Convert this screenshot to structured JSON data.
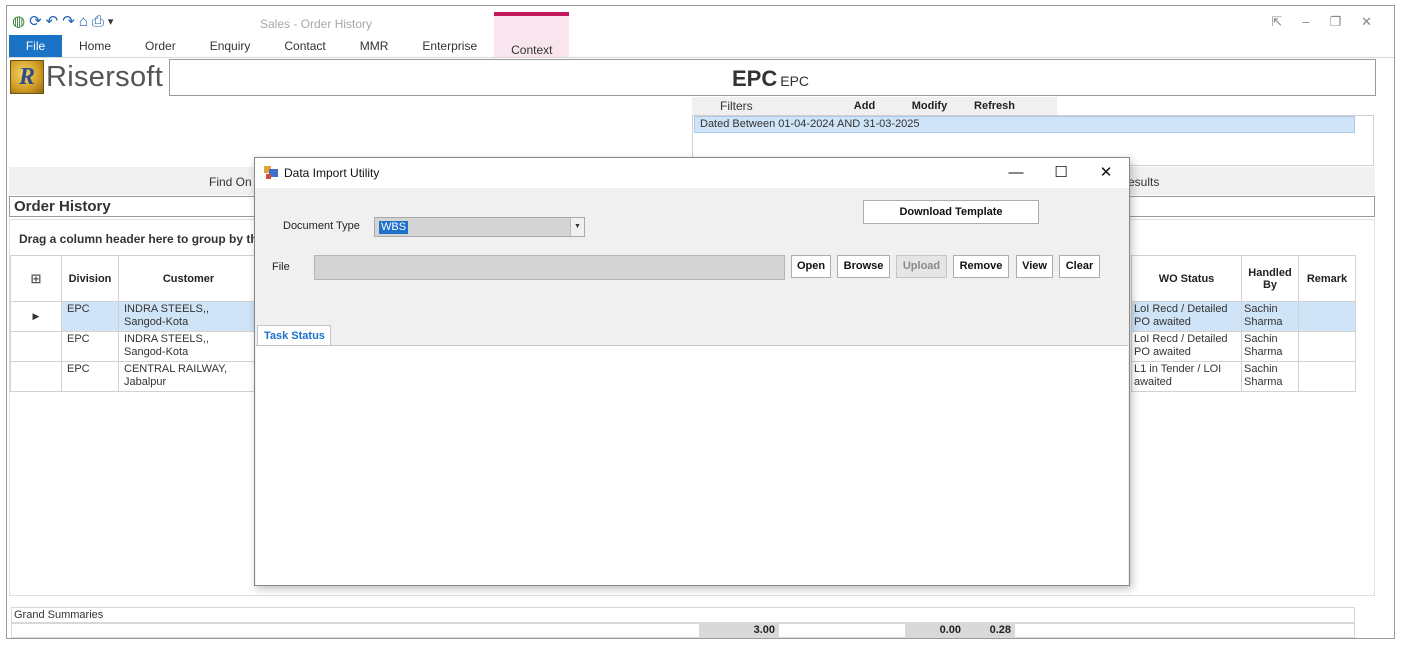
{
  "app": {
    "title": "Sales - Order History",
    "logo_text": "Risersoft",
    "logo_mark": "R"
  },
  "qat": {
    "icons": [
      "app-icon",
      "refresh-icon",
      "undo-icon",
      "redo-icon",
      "home-icon",
      "print-icon",
      "dropdown-icon"
    ],
    "glyphs": [
      "◍",
      "⟳",
      "↶",
      "↷",
      "⌂",
      "⎙",
      "▾"
    ]
  },
  "window_controls": {
    "restore_ribbon": "⇱",
    "minimize": "–",
    "restore": "❐",
    "close": "✕"
  },
  "ribbon": {
    "tabs": [
      "File",
      "Home",
      "Order",
      "Enquiry",
      "Contact",
      "MMR",
      "Enterprise",
      "Context"
    ],
    "context_color": "#c2185b"
  },
  "header": {
    "title": "EPC",
    "subtitle": "EPC"
  },
  "filters": {
    "label": "Filters",
    "add": "Add",
    "modify": "Modify",
    "refresh": "Refresh",
    "items": [
      "Dated Between  01-04-2024 AND 31-03-2025"
    ]
  },
  "find": {
    "label": "Find On",
    "results_label": "esults"
  },
  "section": {
    "title": "Order History",
    "group_hint": "Drag a column header here to group by th"
  },
  "grid": {
    "columns": [
      "Division",
      "Customer"
    ],
    "right_columns": [
      "WO Status",
      "Handled By",
      "Remark"
    ],
    "rows": [
      {
        "division": "EPC",
        "customer": "INDRA STEELS,, Sangod-Kota",
        "wo_status": "LoI Recd / Detailed PO awaited",
        "handled_by": "Sachin Sharma",
        "remark": "",
        "selected": true
      },
      {
        "division": "EPC",
        "customer": "INDRA STEELS,, Sangod-Kota",
        "wo_status": "LoI Recd / Detailed PO awaited",
        "handled_by": "Sachin Sharma",
        "remark": "",
        "selected": false
      },
      {
        "division": "EPC",
        "customer": "CENTRAL RAILWAY, Jabalpur",
        "wo_status": "L1 in Tender / LOI awaited",
        "handled_by": "Sachin Sharma",
        "remark": "",
        "selected": false
      }
    ]
  },
  "summaries": {
    "label": "Grand Summaries",
    "values": [
      "3.00",
      "0.00",
      "0.28"
    ]
  },
  "dialog": {
    "title": "Data Import Utility",
    "controls": {
      "minimize": "—",
      "maximize": "☐",
      "close": "✕"
    },
    "doc_type_label": "Document Type",
    "doc_type_value": "WBS",
    "download_template": "Download Template",
    "file_label": "File",
    "file_value": "",
    "buttons": {
      "open": "Open",
      "browse": "Browse",
      "upload": "Upload",
      "remove": "Remove",
      "view": "View",
      "clear": "Clear"
    },
    "task_tab": "Task Status"
  }
}
